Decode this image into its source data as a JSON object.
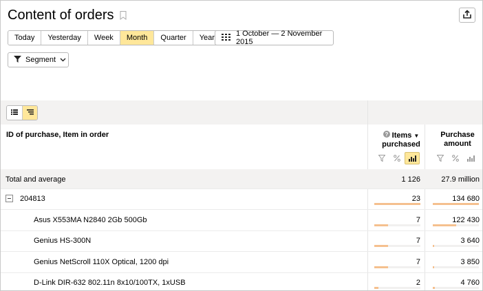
{
  "header": {
    "title": "Content of orders",
    "icons": {
      "bookmark": "bookmark-icon",
      "export": "export-icon"
    }
  },
  "periods": [
    {
      "label": "Today",
      "active": false
    },
    {
      "label": "Yesterday",
      "active": false
    },
    {
      "label": "Week",
      "active": false
    },
    {
      "label": "Month",
      "active": true
    },
    {
      "label": "Quarter",
      "active": false
    },
    {
      "label": "Year",
      "active": false
    }
  ],
  "date_range": {
    "label": "1 October — 2 November 2015",
    "icon": "calendar-icon"
  },
  "segment": {
    "label": "Segment",
    "icons": [
      "filter-icon",
      "chevron-down-icon"
    ]
  },
  "view_toggle": {
    "options": [
      {
        "icon": "list-view-icon",
        "active": false
      },
      {
        "icon": "tree-view-icon",
        "active": true
      }
    ]
  },
  "table": {
    "dimension_header": "ID of purchase, Item in order",
    "metrics": [
      {
        "label_line1": "Items",
        "label_line2": "purchased",
        "sorted": "desc",
        "has_help": true,
        "active_tool": "bar-chart-icon"
      },
      {
        "label_line1": "Purchase",
        "label_line2": "amount",
        "sorted": null,
        "has_help": false,
        "active_tool": null
      }
    ],
    "metric_tools": [
      "filter-icon",
      "percent-icon",
      "bar-chart-icon"
    ],
    "total": {
      "label": "Total and average",
      "items": "1 126",
      "amount": "27.9 million"
    },
    "rows": [
      {
        "label": "204813",
        "items": "23",
        "amount": "134 680",
        "items_share": 1.0,
        "amount_share": 1.0,
        "level": 0,
        "expanded": true
      },
      {
        "label": "Asus X553MA N2840 2Gb 500Gb",
        "items": "7",
        "amount": "122 430",
        "items_share": 0.3,
        "amount_share": 0.5,
        "level": 1
      },
      {
        "label": "Genius HS-300N",
        "items": "7",
        "amount": "3 640",
        "items_share": 0.3,
        "amount_share": 0.03,
        "level": 1
      },
      {
        "label": "Genius NetScroll 110X Optical, 1200 dpi",
        "items": "7",
        "amount": "3 850",
        "items_share": 0.3,
        "amount_share": 0.03,
        "level": 1
      },
      {
        "label": "D-Link DIR-632 802.11n 8x10/100TX, 1xUSB",
        "items": "2",
        "amount": "4 760",
        "items_share": 0.09,
        "amount_share": 0.04,
        "level": 1
      }
    ]
  },
  "colors": {
    "active_bg": "#ffe79a",
    "bar": "#f5c08e",
    "header_bg": "#f3f2f1"
  }
}
